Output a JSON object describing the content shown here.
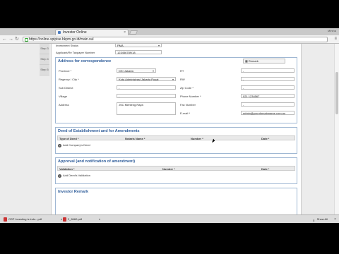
{
  "browser": {
    "tab_title": "Investor Online",
    "tab_close": "×",
    "user_label": "Mirsha",
    "url": "https://online-spipise.bkpm.go.id/main.sul",
    "back": "←",
    "forward": "→",
    "reload": "↻",
    "menu": "≡"
  },
  "steps": [
    "Step 3",
    "Step 4",
    "Step 5"
  ],
  "top_fields": {
    "investment_status_label": "Investment Status",
    "investment_status_value": "PMA",
    "npwp_label": "Applicant/Re Taxpayer Number",
    "npwp_value": "123456789/18"
  },
  "correspondence": {
    "title": "Address for correspondence",
    "remark_button": "Remark",
    "province_label": "Province *",
    "province_value": "DKI Jakarta",
    "regency_label": "Regency / City *",
    "regency_value": "Kota Administrasi Jakarta Pusat",
    "subdistrict_label": "Sub District",
    "subdistrict_value": "-",
    "village_label": "Village",
    "village_value": "-",
    "address_label": "Address",
    "address_value": "JSC Menteng Raya",
    "rt_label": "RT",
    "rt_value": "-",
    "rw_label": "RW",
    "rw_value": "-",
    "zip_label": "Zip Code *",
    "zip_value": "-",
    "phone_label": "Phone Number *",
    "phone_value": "021 1234567",
    "fax_label": "Fax Number",
    "fax_value": "-",
    "email_label": "E-mail *",
    "email_value": "admin@yourdomainname.com.au"
  },
  "deed": {
    "title": "Deed of Establishment and for Amendments",
    "columns": [
      "Type of Deed *",
      "Notaris Name *",
      "Number *",
      "Date *"
    ],
    "add_label": "Add Company's Deed"
  },
  "approval": {
    "title": "Approval (and notification of amendment)",
    "columns": [
      "Validation *",
      "Number *",
      "Date *"
    ],
    "add_label": "Add Deed's Validation"
  },
  "investor_remark": {
    "title": "Investor Remark"
  },
  "downloads": {
    "items": [
      "OSP Investing is indo...pdf",
      "2_8460.pdf"
    ],
    "show_all": "Show All",
    "close": "×"
  }
}
